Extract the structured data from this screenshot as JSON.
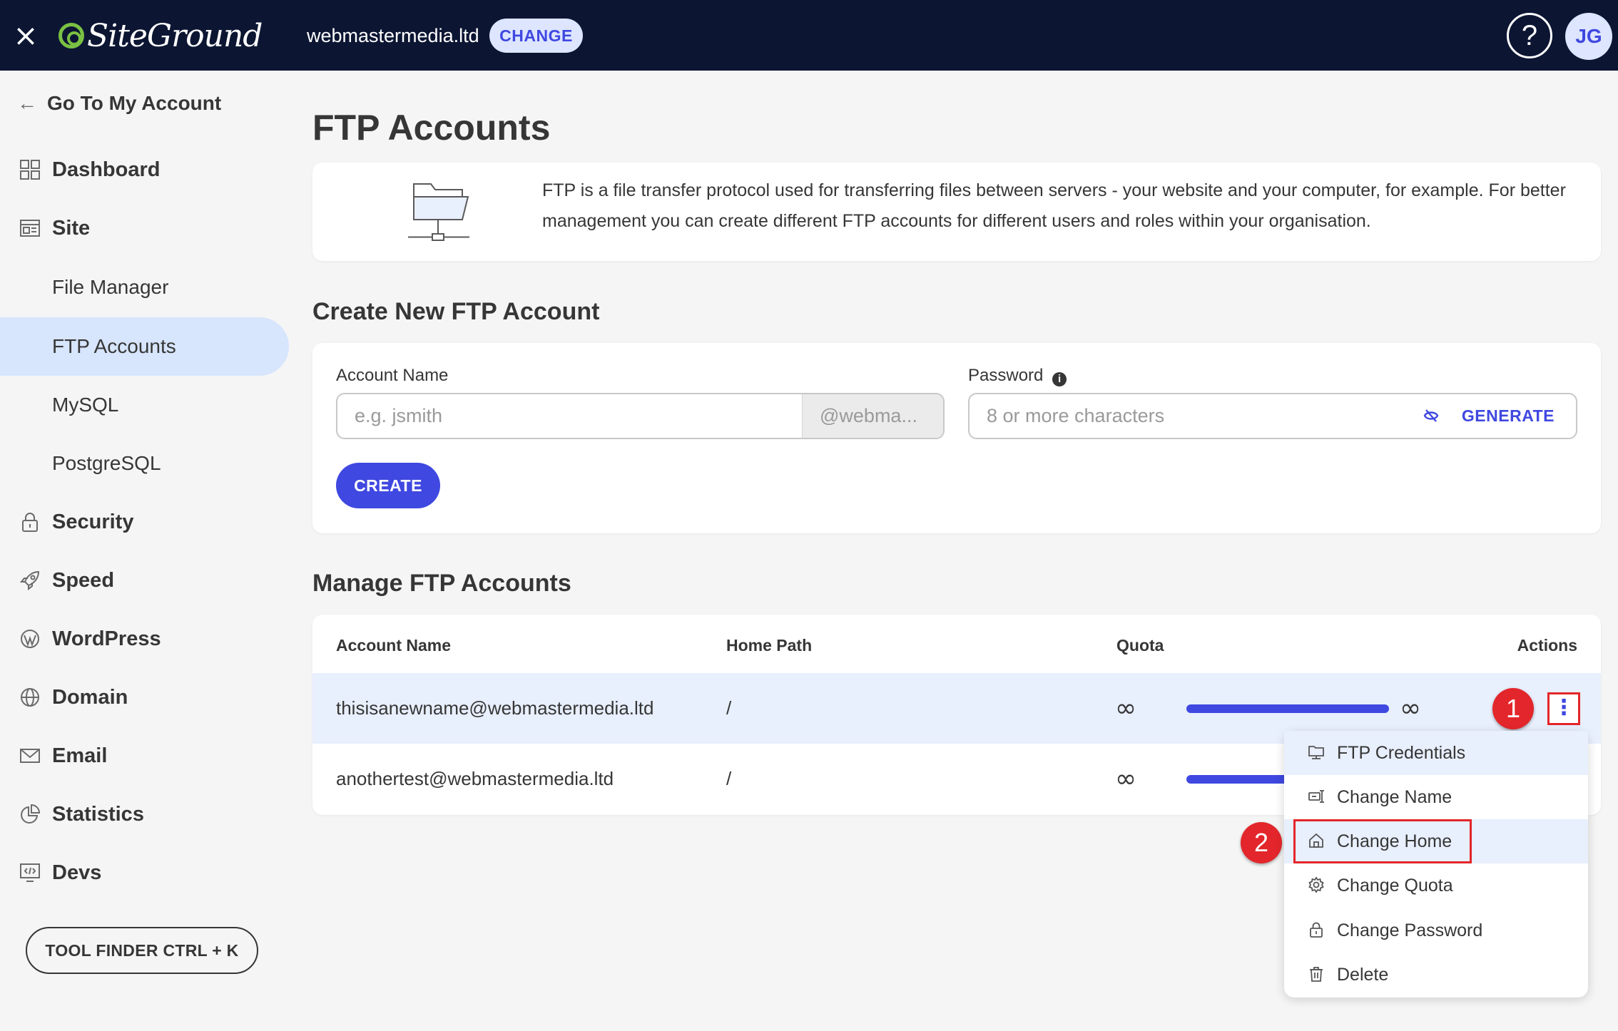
{
  "topbar": {
    "close_icon": "×",
    "brand": "SiteGround",
    "site_name": "webmastermedia.ltd",
    "change_label": "CHANGE",
    "help_icon": "?",
    "avatar_initials": "JG"
  },
  "sidebar": {
    "back_label": "Go To My Account",
    "dashboard": "Dashboard",
    "site": "Site",
    "sub_items": [
      "File Manager",
      "FTP Accounts",
      "MySQL",
      "PostgreSQL"
    ],
    "security": "Security",
    "speed": "Speed",
    "wordpress": "WordPress",
    "domain": "Domain",
    "email": "Email",
    "statistics": "Statistics",
    "devs": "Devs",
    "tool_finder": "TOOL FINDER CTRL + K"
  },
  "main": {
    "title": "FTP Accounts",
    "info_text": "FTP is a file transfer protocol used for transferring files between servers - your website and your computer, for example. For better management you can create different FTP accounts for different users and roles within your organisation.",
    "create_title": "Create New FTP Account",
    "account_name_label": "Account Name",
    "account_name_placeholder": "e.g. jsmith",
    "account_suffix": "@webma...",
    "password_label": "Password",
    "password_placeholder": "8 or more characters",
    "generate_label": "GENERATE",
    "create_label": "CREATE",
    "manage_title": "Manage FTP Accounts",
    "columns": [
      "Account Name",
      "Home Path",
      "Quota",
      "Actions"
    ],
    "rows": [
      {
        "account": "thisisanewname@webmastermedia.ltd",
        "home": "/",
        "quota_used": "∞",
        "quota_total": "∞"
      },
      {
        "account": "anothertest@webmastermedia.ltd",
        "home": "/",
        "quota_used": "∞",
        "quota_total": "∞"
      }
    ],
    "kebab_icon": "⋮",
    "badges": [
      "1",
      "2"
    ]
  },
  "menu": {
    "items": [
      "FTP Credentials",
      "Change Name",
      "Change Home",
      "Change Quota",
      "Change Password",
      "Delete"
    ]
  },
  "colors": {
    "topbar": "#0c1633",
    "accent": "#3f48e0",
    "highlight": "#e8effd",
    "annotation": "#e3262b"
  }
}
